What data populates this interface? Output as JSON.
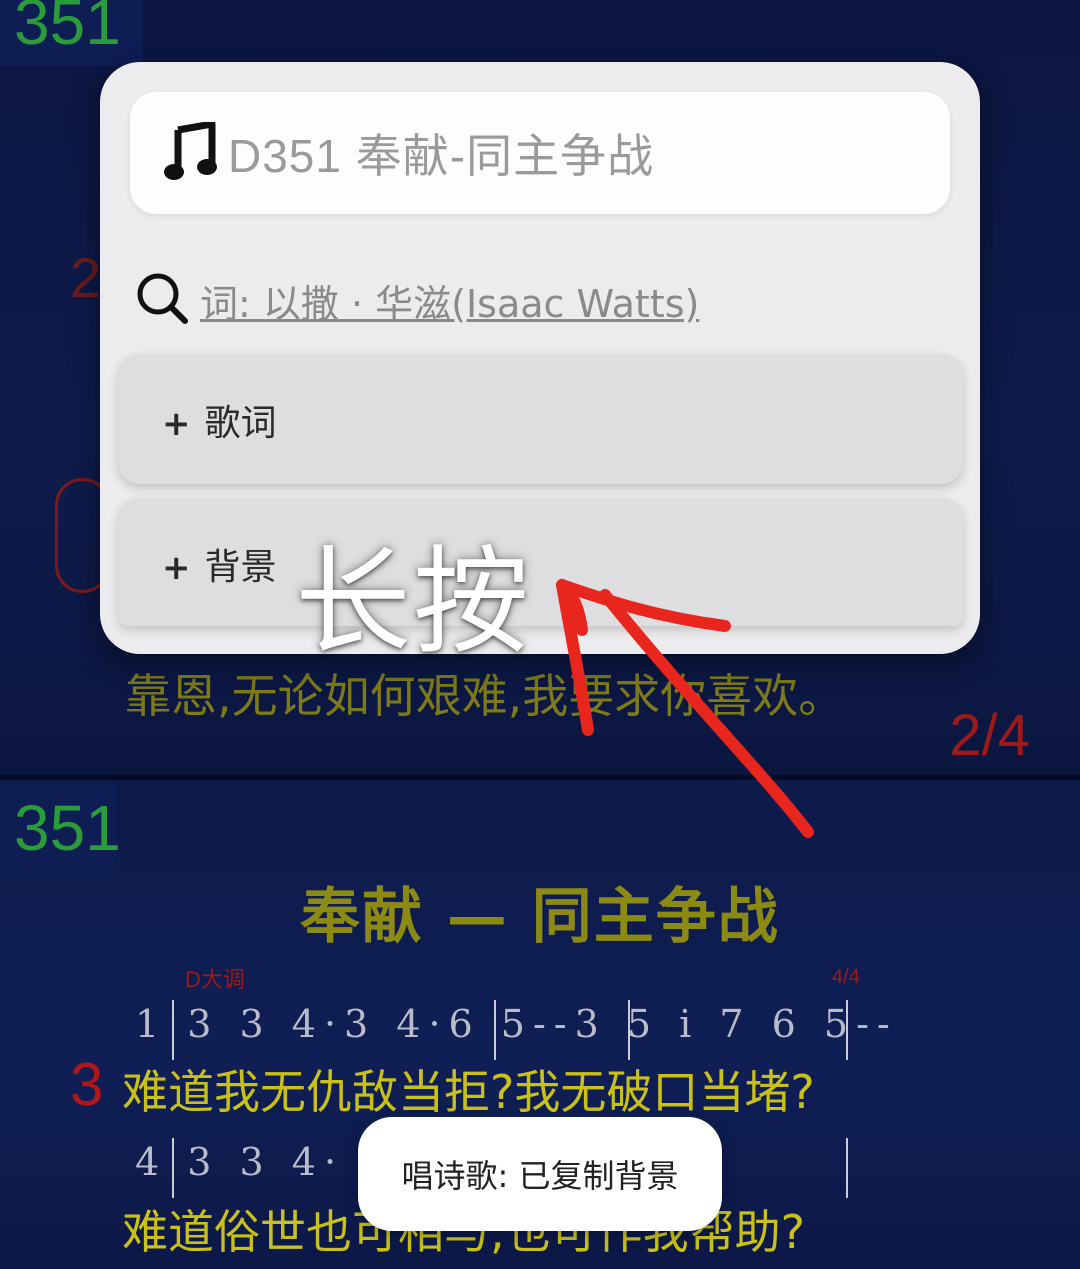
{
  "background": {
    "top_number": "351",
    "top_lyric_line": "靠恩,无论如何艰难,我要求你喜欢。",
    "top_time_signature": "2/4",
    "bottom_number": "351",
    "song_title": "奉献 — 同主争战",
    "key_label": "D大调",
    "time_signature": "4/4",
    "verse_number": "3",
    "notation_line_1": "1 3 3 4·3 4·6 5--3 5 i 7 6 5--",
    "lyric_line_1": "难道我无仇敌当拒?我无破口当堵?",
    "notation_line_2": "4 3 3 4·   2·1 1--",
    "lyric_line_2": "难道俗世也可相与,也可作我帮助?"
  },
  "popup": {
    "title": "D351 奉献-同主争战",
    "title_icon": "music-note-icon",
    "author_link": "词: 以撒 · 华滋(Isaac Watts)",
    "search_icon": "search-icon",
    "lyrics_button": {
      "prefix": "+",
      "label": "歌词"
    },
    "background_button": {
      "prefix": "+",
      "label": "背景"
    }
  },
  "annotation": {
    "text": "长按",
    "arrow_color": "#e8261e"
  },
  "toast": {
    "text": "唱诗歌: 已复制背景"
  }
}
